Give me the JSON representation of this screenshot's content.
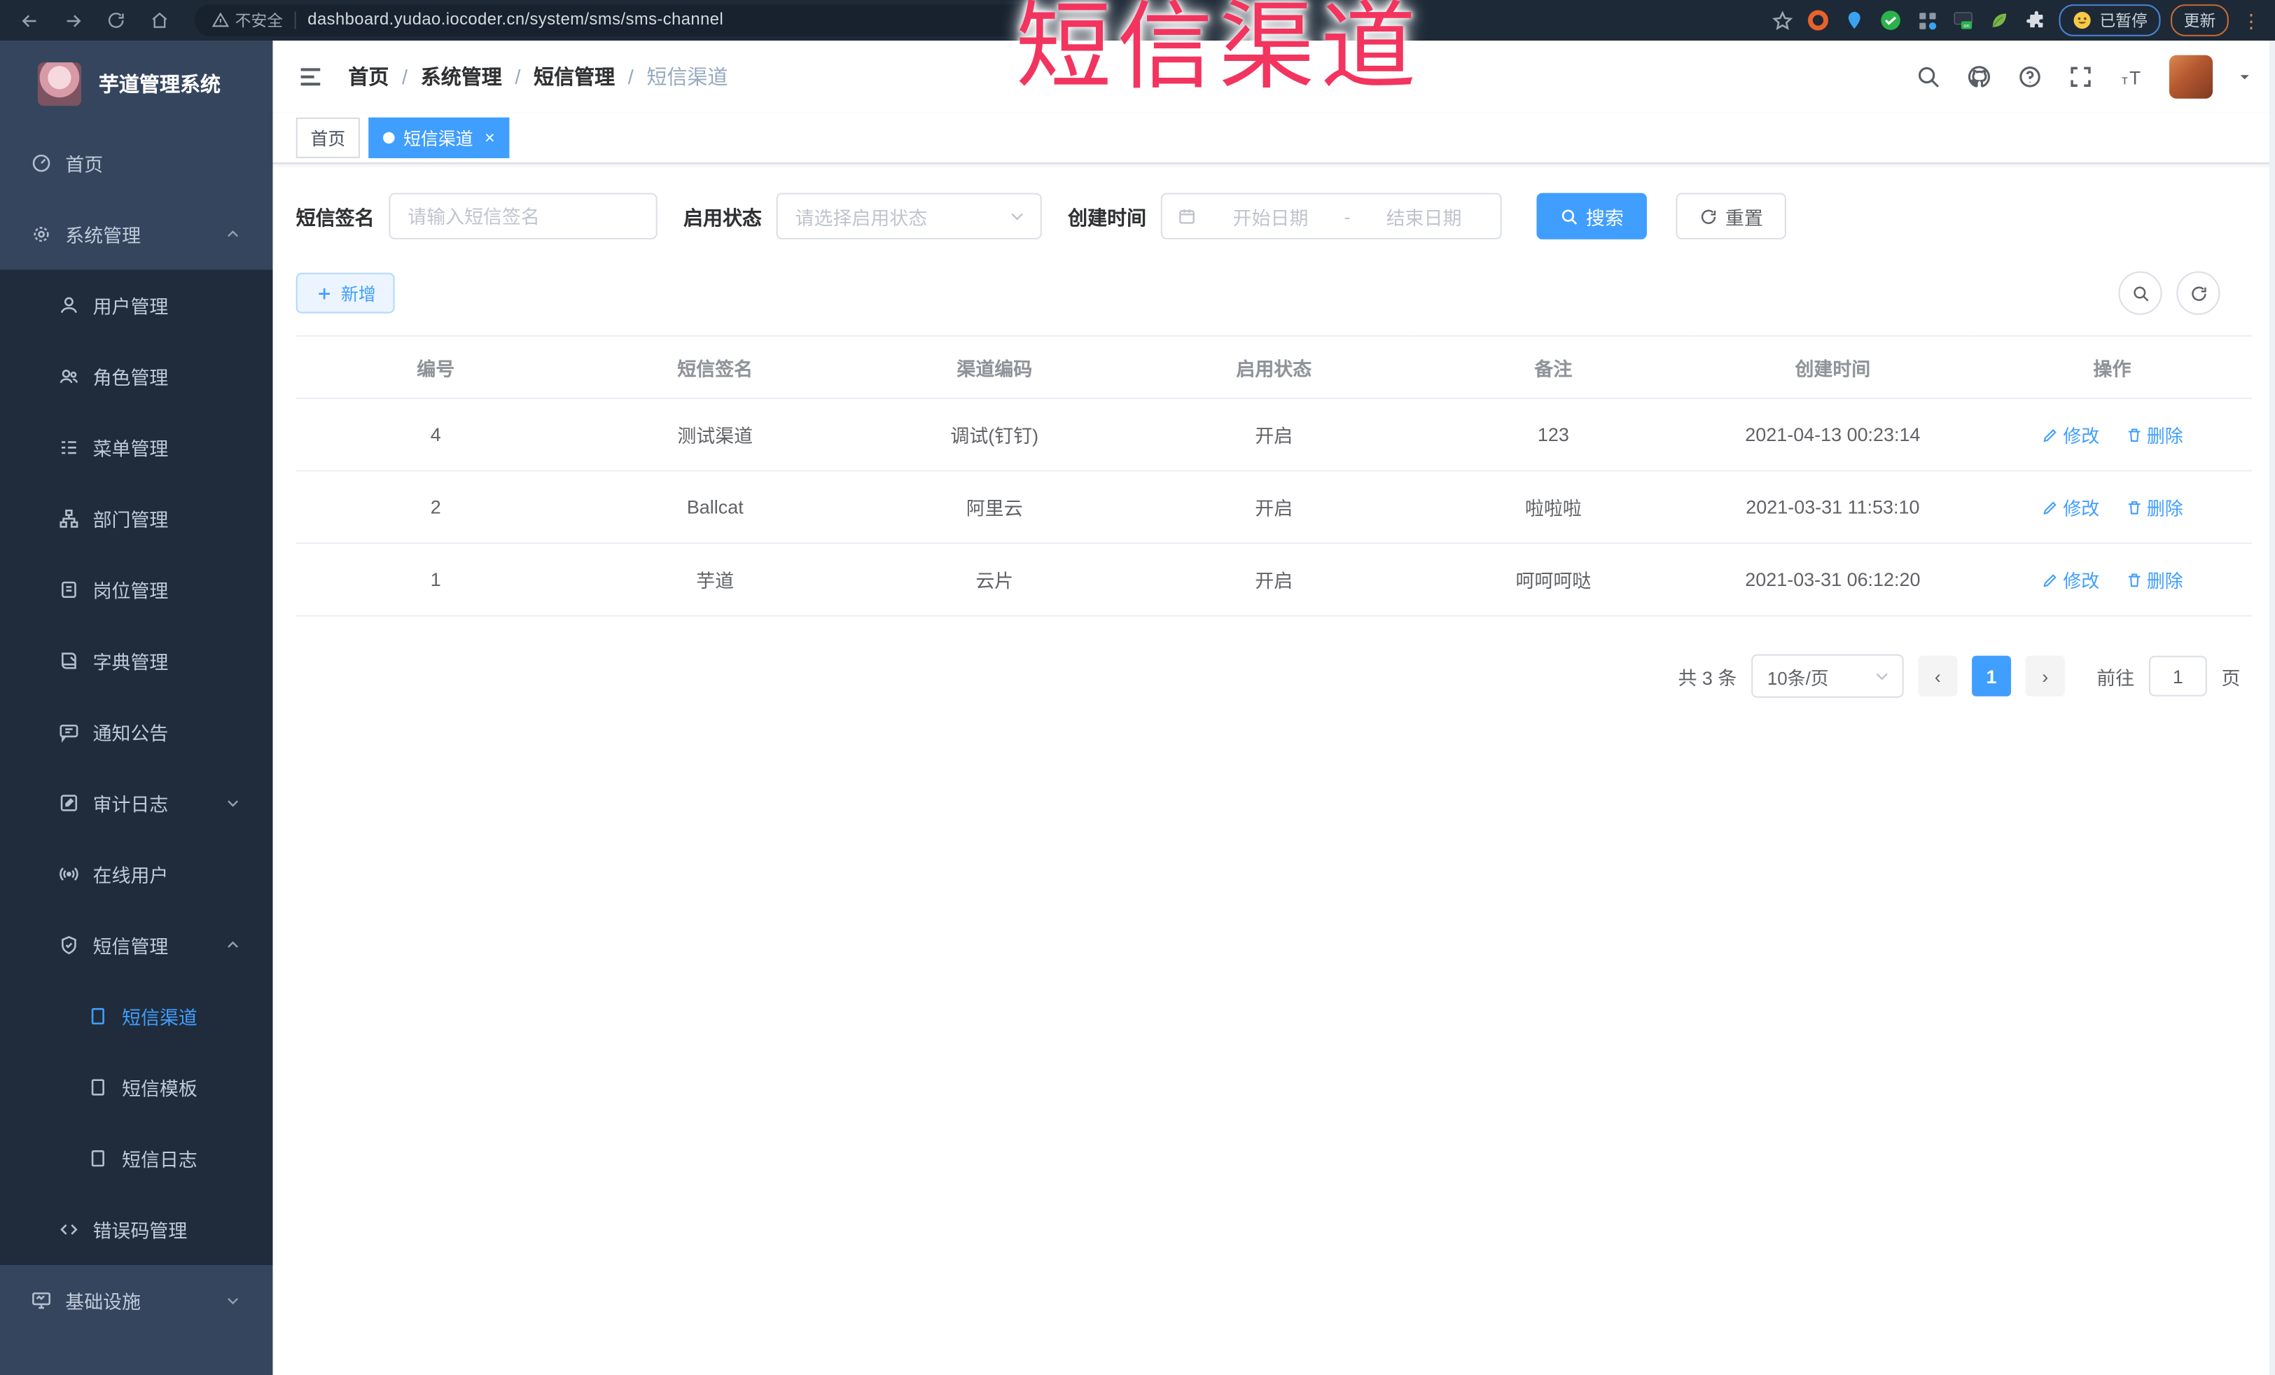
{
  "browser": {
    "security_label": "不安全",
    "url": "dashboard.yudao.iocoder.cn/system/sms/sms-channel",
    "paused_chip": "已暂停",
    "update_chip": "更新"
  },
  "overlay": {
    "text": "短信渠道",
    "color": "#f2345e"
  },
  "sidebar": {
    "logo_title": "芋道管理系统",
    "items": [
      {
        "label": "首页",
        "icon": "dashboard-icon",
        "level": 1
      },
      {
        "label": "系统管理",
        "icon": "gear-icon",
        "level": 1,
        "arrow": "up"
      },
      {
        "label": "用户管理",
        "icon": "user-icon",
        "level": 2
      },
      {
        "label": "角色管理",
        "icon": "roles-icon",
        "level": 2
      },
      {
        "label": "菜单管理",
        "icon": "menu-list-icon",
        "level": 2
      },
      {
        "label": "部门管理",
        "icon": "org-tree-icon",
        "level": 2
      },
      {
        "label": "岗位管理",
        "icon": "post-icon",
        "level": 2
      },
      {
        "label": "字典管理",
        "icon": "dict-icon",
        "level": 2
      },
      {
        "label": "通知公告",
        "icon": "notice-icon",
        "level": 2
      },
      {
        "label": "审计日志",
        "icon": "audit-log-icon",
        "level": 2,
        "arrow": "down"
      },
      {
        "label": "在线用户",
        "icon": "online-user-icon",
        "level": 2
      },
      {
        "label": "短信管理",
        "icon": "sms-shield-icon",
        "level": 2,
        "arrow": "up"
      },
      {
        "label": "短信渠道",
        "icon": "doc-icon",
        "level": 3,
        "active": true
      },
      {
        "label": "短信模板",
        "icon": "doc-icon",
        "level": 3
      },
      {
        "label": "短信日志",
        "icon": "doc-icon",
        "level": 3
      },
      {
        "label": "错误码管理",
        "icon": "code-icon",
        "level": 2
      },
      {
        "label": "基础设施",
        "icon": "monitor-icon",
        "level": 1,
        "arrow": "down"
      }
    ]
  },
  "breadcrumb": [
    "首页",
    "系统管理",
    "短信管理",
    "短信渠道"
  ],
  "breadcrumb_separator": "/",
  "tabs": [
    {
      "label": "首页",
      "active": false
    },
    {
      "label": "短信渠道",
      "active": true
    }
  ],
  "filters": {
    "sign_label": "短信签名",
    "sign_placeholder": "请输入短信签名",
    "status_label": "启用状态",
    "status_placeholder": "请选择启用状态",
    "time_label": "创建时间",
    "start_placeholder": "开始日期",
    "range_separator": "-",
    "end_placeholder": "结束日期",
    "search_label": "搜索",
    "reset_label": "重置"
  },
  "toolbar": {
    "add_label": "新增"
  },
  "table": {
    "headers": [
      "编号",
      "短信签名",
      "渠道编码",
      "启用状态",
      "备注",
      "创建时间",
      "操作"
    ],
    "rows": [
      {
        "id": "4",
        "sign": "测试渠道",
        "code": "调试(钉钉)",
        "status": "开启",
        "remark": "123",
        "created": "2021-04-13 00:23:14"
      },
      {
        "id": "2",
        "sign": "Ballcat",
        "code": "阿里云",
        "status": "开启",
        "remark": "啦啦啦",
        "created": "2021-03-31 11:53:10"
      },
      {
        "id": "1",
        "sign": "芋道",
        "code": "云片",
        "status": "开启",
        "remark": "呵呵呵哒",
        "created": "2021-03-31 06:12:20"
      }
    ],
    "edit_label": "修改",
    "delete_label": "删除"
  },
  "pagination": {
    "total": "共 3 条",
    "page_size": "10条/页",
    "prev": "‹",
    "current": "1",
    "next": "›",
    "goto_label": "前往",
    "goto_value": "1",
    "page_suffix": "页"
  },
  "colors": {
    "accent": "#409eff",
    "annotation": "#f2345e",
    "sidebar_bg": "#35455e",
    "submenu_bg": "#202c3b"
  },
  "icons": [
    "back-icon",
    "forward-icon",
    "refresh-icon",
    "home-icon",
    "warning-icon",
    "star-icon",
    "puzzle-icon",
    "search-icon",
    "github-icon",
    "question-icon",
    "fullscreen-icon",
    "font-size-icon",
    "chevron-down-icon",
    "calendar-icon",
    "plus-icon",
    "edit-icon",
    "delete-icon"
  ]
}
